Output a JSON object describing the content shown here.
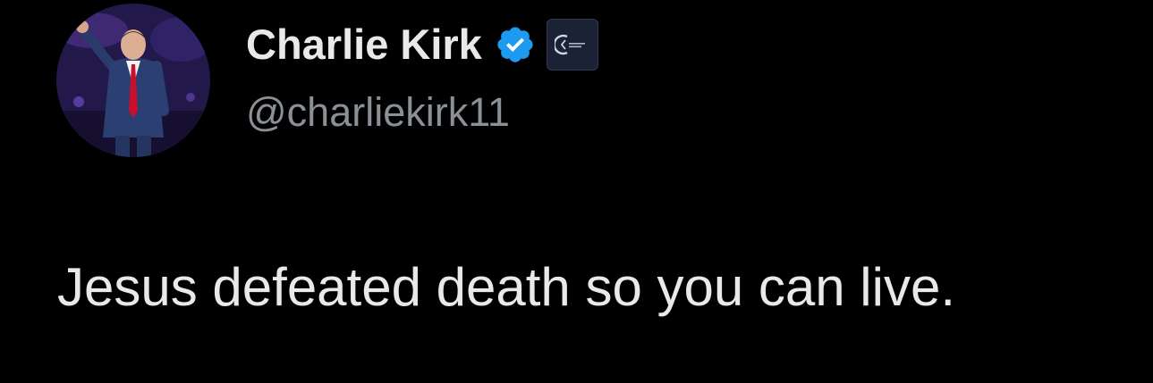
{
  "tweet": {
    "author": {
      "display_name": "Charlie Kirk",
      "handle": "@charliekirk11",
      "verified": true,
      "verified_badge_color": "#1d9bf0",
      "affiliate_badge_icon": "organization-logo-icon"
    },
    "text": "Jesus defeated death so you can live."
  },
  "colors": {
    "background": "#000000",
    "primary_text": "#e7e9ea",
    "secondary_text": "#8b9096",
    "accent": "#1d9bf0"
  }
}
